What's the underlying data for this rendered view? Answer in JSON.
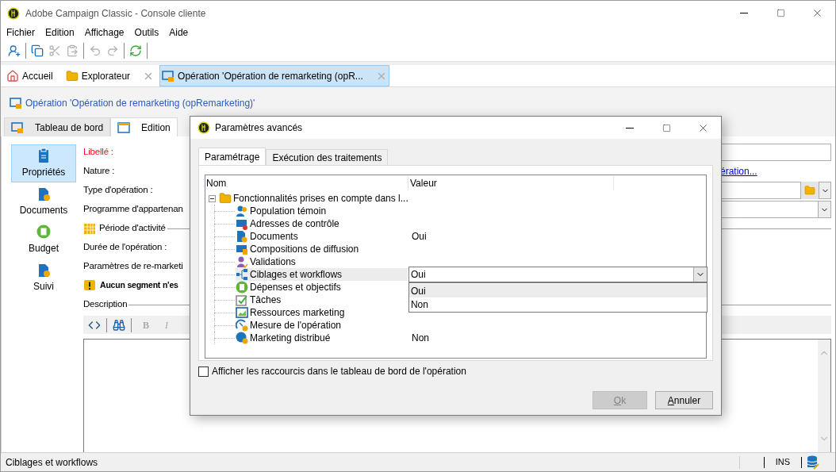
{
  "window": {
    "title": "Adobe Campaign Classic - Console cliente"
  },
  "menu": [
    "Fichier",
    "Edition",
    "Affichage",
    "Outils",
    "Aide"
  ],
  "toolbar": [
    {
      "disabled": false
    },
    {
      "disabled": false
    },
    {
      "disabled": true
    },
    {
      "disabled": true
    },
    {
      "disabled": true
    },
    {
      "disabled": true
    },
    {
      "disabled": false
    }
  ],
  "tabs": [
    {
      "label": "Accueil",
      "selected": false,
      "closable": false
    },
    {
      "label": "Explorateur",
      "selected": false,
      "closable": true
    },
    {
      "label": "Opération 'Opération de remarketing (opR...",
      "selected": true,
      "closable": true
    }
  ],
  "breadcrumb": "Opération 'Opération de remarketing (opRemarketing)'",
  "sub_tabs": [
    {
      "label": "Tableau de bord",
      "selected": false
    },
    {
      "label": "Edition",
      "selected": true
    }
  ],
  "sidebar": {
    "items": [
      {
        "label": "Propriétés",
        "selected": true
      },
      {
        "label": "Documents",
        "selected": false
      },
      {
        "label": "Budget",
        "selected": false
      },
      {
        "label": "Suivi",
        "selected": false
      }
    ]
  },
  "form": {
    "fields": [
      {
        "kind": "input",
        "label": "Libellé :",
        "required": true
      },
      {
        "kind": "link",
        "label": "Nature :",
        "required": false,
        "link": "ération..."
      },
      {
        "kind": "picker",
        "label": "Type d'opération :",
        "required": false
      },
      {
        "kind": "dropdown",
        "label": "Programme d'appartenan",
        "required": false
      },
      {
        "kind": "period",
        "label": "Période d'activité",
        "required": false
      },
      {
        "kind": "text",
        "label": "Durée de l'opération :",
        "required": false
      },
      {
        "kind": "text",
        "label": "Paramètres de re-marketi",
        "required": false
      },
      {
        "kind": "warning",
        "label": "Aucun segment n'es",
        "required": false
      },
      {
        "kind": "section",
        "label": "Description",
        "required": false
      }
    ],
    "editor": {
      "format_buttons": [
        "B",
        "I"
      ]
    }
  },
  "dialog": {
    "title": "Paramètres avancés",
    "tabs": [
      {
        "label": "Paramétrage",
        "selected": true
      },
      {
        "label": "Exécution des traitements",
        "selected": false
      }
    ],
    "tree": {
      "columns": [
        "Nom",
        "Valeur"
      ],
      "root": {
        "label": "Fonctionnalités prises en compte dans l...",
        "expanded": true,
        "children": [
          {
            "label": "Population témoin",
            "selected": false
          },
          {
            "label": "Adresses de contrôle",
            "selected": false
          },
          {
            "label": "Documents",
            "value": "Oui",
            "selected": false
          },
          {
            "label": "Compositions de diffusion",
            "selected": false
          },
          {
            "label": "Validations",
            "selected": false
          },
          {
            "label": "Ciblages et workflows",
            "selected": true,
            "dropdown": {
              "value": "Oui",
              "open": true,
              "options": [
                {
                  "label": "Oui",
                  "selected": true
                },
                {
                  "label": "Non",
                  "selected": false
                }
              ]
            }
          },
          {
            "label": "Dépenses et objectifs",
            "selected": false
          },
          {
            "label": "Tâches",
            "selected": false
          },
          {
            "label": "Ressources marketing",
            "selected": false
          },
          {
            "label": "Mesure de l'opération",
            "selected": false
          },
          {
            "label": "Marketing distribué",
            "value": "Non",
            "selected": false
          }
        ]
      }
    },
    "checkbox": {
      "label": "Afficher les raccourcis dans le tableau de bord de l'opération",
      "checked": false
    },
    "buttons": [
      {
        "label": "Ok",
        "disabled": true
      },
      {
        "label": "Annuler",
        "disabled": false
      }
    ]
  },
  "status_bar": {
    "text": "Ciblages et workflows",
    "mode": "INS"
  }
}
